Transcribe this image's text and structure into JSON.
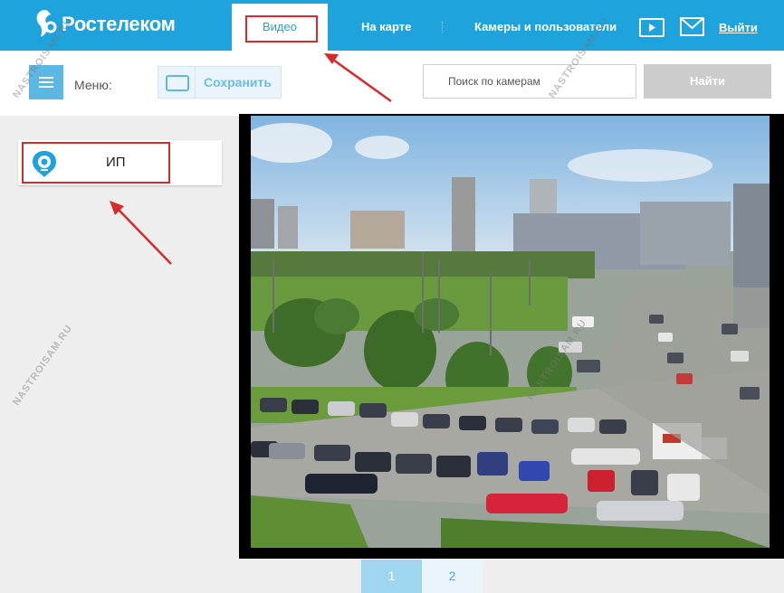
{
  "brand": {
    "name": "Ростелеком"
  },
  "nav": {
    "video": "Видео",
    "map": "На карте",
    "cameras_users": "Камеры и пользователи",
    "logout": "Выйти"
  },
  "toolbar": {
    "menu_label": "Меню:",
    "save_label": "Сохранить",
    "search_placeholder": "Поиск по камерам",
    "find_label": "Найти"
  },
  "cameras": [
    {
      "name": "ИП"
    }
  ],
  "pagination": {
    "pages": [
      "1",
      "2"
    ],
    "active": "1"
  },
  "watermark": "NASTROISAM.RU",
  "colors": {
    "brand": "#1ea3dc",
    "highlight": "#d62b2b",
    "light_accent": "#5bb8e4"
  },
  "icons": [
    "rostelecom-logo-icon",
    "play-icon",
    "mail-icon",
    "menu-icon",
    "save-layout-icon",
    "camera-icon"
  ]
}
